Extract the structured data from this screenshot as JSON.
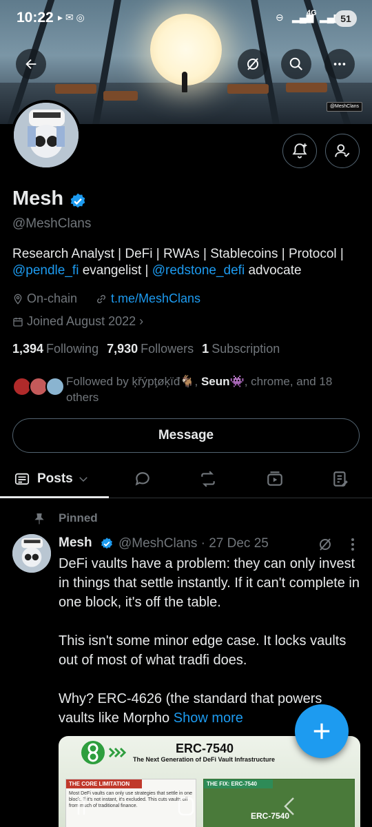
{
  "status_bar": {
    "time": "10:22",
    "network": "4G",
    "battery": "51"
  },
  "banner": {
    "watermark": "@MeshClans"
  },
  "header": {
    "back_icon": "arrow-left-icon",
    "grok_icon": "grok-icon",
    "search_icon": "search-icon",
    "more_icon": "more-icon"
  },
  "profile": {
    "name": "Mesh",
    "handle": "@MeshClans",
    "bio_prefix": "Research Analyst | DeFi | RWAs | Stablecoins | Protocol |",
    "bio_mention1": "@pendle_fi",
    "bio_mid": " evangelist | ",
    "bio_mention2": "@redstone_defi",
    "bio_suffix": " advocate",
    "location": "On-chain",
    "website": "t.me/MeshClans",
    "joined": "Joined August 2022",
    "following_count": "1,394",
    "following_label": "Following",
    "followers_count": "7,930",
    "followers_label": "Followers",
    "subscription_count": "1",
    "subscription_label": "Subscription",
    "followed_by_prefix": "Followed by ",
    "followed_by_user1": "ķřýpţøķïđ",
    "followed_by_user2": "Seun",
    "followed_by_suffix": ", chrome, and 18 others",
    "message_label": "Message"
  },
  "tabs": {
    "posts_label": "Posts"
  },
  "post": {
    "pinned_label": "Pinned",
    "author": "Mesh",
    "meta": "@MeshClans · 27 Dec 25",
    "paragraph1": "DeFi vaults have a problem: they can only invest in things that settle instantly. If it can't complete in one block, it's off the table.",
    "paragraph2": "This isn't some minor edge case. It locks vaults out of most of what tradfi does.",
    "paragraph3": "Why? ERC-4626 (the standard that powers vaults like Morpho",
    "show_more": "Show more",
    "card": {
      "title": "ERC-7540",
      "subtitle": "The Next Generation of DeFi Vault Infrastructure",
      "limit_header": "THE CORE LIMITATION",
      "limit_text": "Most DeFi vaults can only use strategies that settle in one block. If it's not instant, it's excluded. This cuts vaults off from much of traditional finance.",
      "fix_header": "THE FIX: ERC-7540",
      "fix_label": "ERC-7540"
    }
  },
  "colors": {
    "accent": "#1d9bf0",
    "background": "#000000",
    "muted": "#71767b"
  }
}
